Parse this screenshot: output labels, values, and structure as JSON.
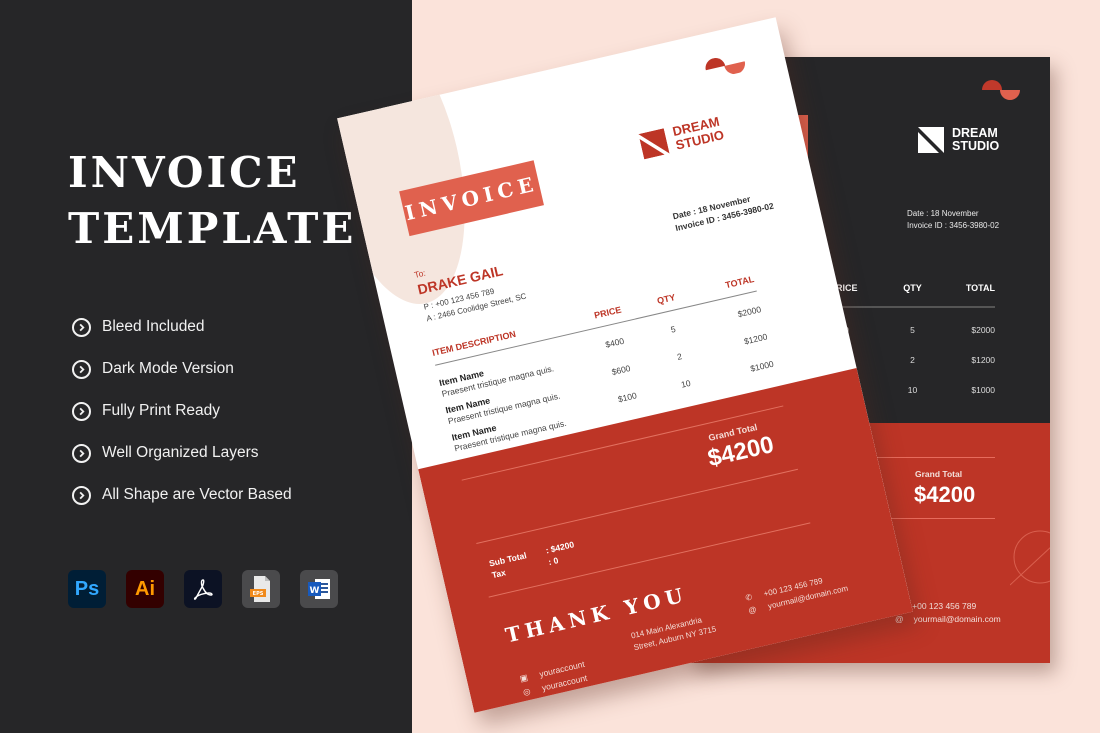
{
  "left": {
    "title_line1": "INVOICE",
    "title_line2": "TEMPLATE",
    "features": [
      "Bleed Included",
      "Dark Mode Version",
      "Fully Print Ready",
      "Well Organized Layers",
      "All Shape are Vector Based"
    ],
    "apps": [
      {
        "name": "photoshop-icon",
        "label": "Ps"
      },
      {
        "name": "illustrator-icon",
        "label": "Ai"
      },
      {
        "name": "acrobat-icon",
        "label": ""
      },
      {
        "name": "eps-file-icon",
        "label": "EPS"
      },
      {
        "name": "word-icon",
        "label": "W"
      }
    ]
  },
  "invoice": {
    "badge": "INVOICE",
    "brand_line1": "DREAM",
    "brand_line2": "STUDIO",
    "date": "Date : 18 November",
    "invoice_id": "Invoice ID : 3456-3980-02",
    "to_label": "To:",
    "client_name": "DRAKE GAIL",
    "client_phone": "P : +00 123 456 789",
    "client_address": "A : 2466 Coolidge Street, SC",
    "columns": [
      "ITEM DESCRIPTION",
      "PRICE",
      "QTY",
      "TOTAL"
    ],
    "items": [
      {
        "name": "Item Name",
        "desc": "Praesent tristique magna quis.",
        "price": "$400",
        "qty": "5",
        "total": "$2000"
      },
      {
        "name": "Item Name",
        "desc": "Praesent tristique magna quis.",
        "price": "$600",
        "qty": "2",
        "total": "$1200"
      },
      {
        "name": "Item Name",
        "desc": "Praesent tristique magna quis.",
        "price": "$100",
        "qty": "10",
        "total": "$1000"
      }
    ],
    "grand_total_label": "Grand Total",
    "grand_total": "$4200",
    "subtotal_label": "Sub Total",
    "subtotal_value": ": $4200",
    "tax_label": "Tax",
    "tax_value": ": 0",
    "thank_you": "THANK YOU",
    "social": [
      "youraccount",
      "youraccount"
    ],
    "address_line1": "014 Main Alexandria",
    "address_line2": "Street, Auburn NY 3715",
    "phone": "+00 123 456 789",
    "email": "yourmail@domain.com"
  },
  "colors": {
    "dark": "#262628",
    "red": "#bd3526",
    "coral": "#e0614e",
    "peach_bg": "#fbe3da"
  }
}
